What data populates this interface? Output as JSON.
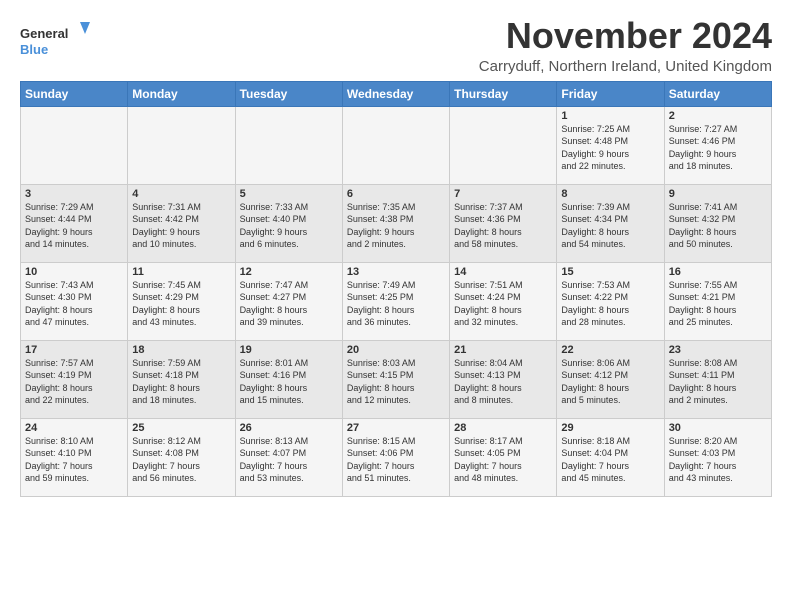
{
  "logo": {
    "line1": "General",
    "line2": "Blue"
  },
  "title": "November 2024",
  "location": "Carryduff, Northern Ireland, United Kingdom",
  "weekdays": [
    "Sunday",
    "Monday",
    "Tuesday",
    "Wednesday",
    "Thursday",
    "Friday",
    "Saturday"
  ],
  "weeks": [
    [
      {
        "day": "",
        "info": ""
      },
      {
        "day": "",
        "info": ""
      },
      {
        "day": "",
        "info": ""
      },
      {
        "day": "",
        "info": ""
      },
      {
        "day": "",
        "info": ""
      },
      {
        "day": "1",
        "info": "Sunrise: 7:25 AM\nSunset: 4:48 PM\nDaylight: 9 hours\nand 22 minutes."
      },
      {
        "day": "2",
        "info": "Sunrise: 7:27 AM\nSunset: 4:46 PM\nDaylight: 9 hours\nand 18 minutes."
      }
    ],
    [
      {
        "day": "3",
        "info": "Sunrise: 7:29 AM\nSunset: 4:44 PM\nDaylight: 9 hours\nand 14 minutes."
      },
      {
        "day": "4",
        "info": "Sunrise: 7:31 AM\nSunset: 4:42 PM\nDaylight: 9 hours\nand 10 minutes."
      },
      {
        "day": "5",
        "info": "Sunrise: 7:33 AM\nSunset: 4:40 PM\nDaylight: 9 hours\nand 6 minutes."
      },
      {
        "day": "6",
        "info": "Sunrise: 7:35 AM\nSunset: 4:38 PM\nDaylight: 9 hours\nand 2 minutes."
      },
      {
        "day": "7",
        "info": "Sunrise: 7:37 AM\nSunset: 4:36 PM\nDaylight: 8 hours\nand 58 minutes."
      },
      {
        "day": "8",
        "info": "Sunrise: 7:39 AM\nSunset: 4:34 PM\nDaylight: 8 hours\nand 54 minutes."
      },
      {
        "day": "9",
        "info": "Sunrise: 7:41 AM\nSunset: 4:32 PM\nDaylight: 8 hours\nand 50 minutes."
      }
    ],
    [
      {
        "day": "10",
        "info": "Sunrise: 7:43 AM\nSunset: 4:30 PM\nDaylight: 8 hours\nand 47 minutes."
      },
      {
        "day": "11",
        "info": "Sunrise: 7:45 AM\nSunset: 4:29 PM\nDaylight: 8 hours\nand 43 minutes."
      },
      {
        "day": "12",
        "info": "Sunrise: 7:47 AM\nSunset: 4:27 PM\nDaylight: 8 hours\nand 39 minutes."
      },
      {
        "day": "13",
        "info": "Sunrise: 7:49 AM\nSunset: 4:25 PM\nDaylight: 8 hours\nand 36 minutes."
      },
      {
        "day": "14",
        "info": "Sunrise: 7:51 AM\nSunset: 4:24 PM\nDaylight: 8 hours\nand 32 minutes."
      },
      {
        "day": "15",
        "info": "Sunrise: 7:53 AM\nSunset: 4:22 PM\nDaylight: 8 hours\nand 28 minutes."
      },
      {
        "day": "16",
        "info": "Sunrise: 7:55 AM\nSunset: 4:21 PM\nDaylight: 8 hours\nand 25 minutes."
      }
    ],
    [
      {
        "day": "17",
        "info": "Sunrise: 7:57 AM\nSunset: 4:19 PM\nDaylight: 8 hours\nand 22 minutes."
      },
      {
        "day": "18",
        "info": "Sunrise: 7:59 AM\nSunset: 4:18 PM\nDaylight: 8 hours\nand 18 minutes."
      },
      {
        "day": "19",
        "info": "Sunrise: 8:01 AM\nSunset: 4:16 PM\nDaylight: 8 hours\nand 15 minutes."
      },
      {
        "day": "20",
        "info": "Sunrise: 8:03 AM\nSunset: 4:15 PM\nDaylight: 8 hours\nand 12 minutes."
      },
      {
        "day": "21",
        "info": "Sunrise: 8:04 AM\nSunset: 4:13 PM\nDaylight: 8 hours\nand 8 minutes."
      },
      {
        "day": "22",
        "info": "Sunrise: 8:06 AM\nSunset: 4:12 PM\nDaylight: 8 hours\nand 5 minutes."
      },
      {
        "day": "23",
        "info": "Sunrise: 8:08 AM\nSunset: 4:11 PM\nDaylight: 8 hours\nand 2 minutes."
      }
    ],
    [
      {
        "day": "24",
        "info": "Sunrise: 8:10 AM\nSunset: 4:10 PM\nDaylight: 7 hours\nand 59 minutes."
      },
      {
        "day": "25",
        "info": "Sunrise: 8:12 AM\nSunset: 4:08 PM\nDaylight: 7 hours\nand 56 minutes."
      },
      {
        "day": "26",
        "info": "Sunrise: 8:13 AM\nSunset: 4:07 PM\nDaylight: 7 hours\nand 53 minutes."
      },
      {
        "day": "27",
        "info": "Sunrise: 8:15 AM\nSunset: 4:06 PM\nDaylight: 7 hours\nand 51 minutes."
      },
      {
        "day": "28",
        "info": "Sunrise: 8:17 AM\nSunset: 4:05 PM\nDaylight: 7 hours\nand 48 minutes."
      },
      {
        "day": "29",
        "info": "Sunrise: 8:18 AM\nSunset: 4:04 PM\nDaylight: 7 hours\nand 45 minutes."
      },
      {
        "day": "30",
        "info": "Sunrise: 8:20 AM\nSunset: 4:03 PM\nDaylight: 7 hours\nand 43 minutes."
      }
    ]
  ]
}
